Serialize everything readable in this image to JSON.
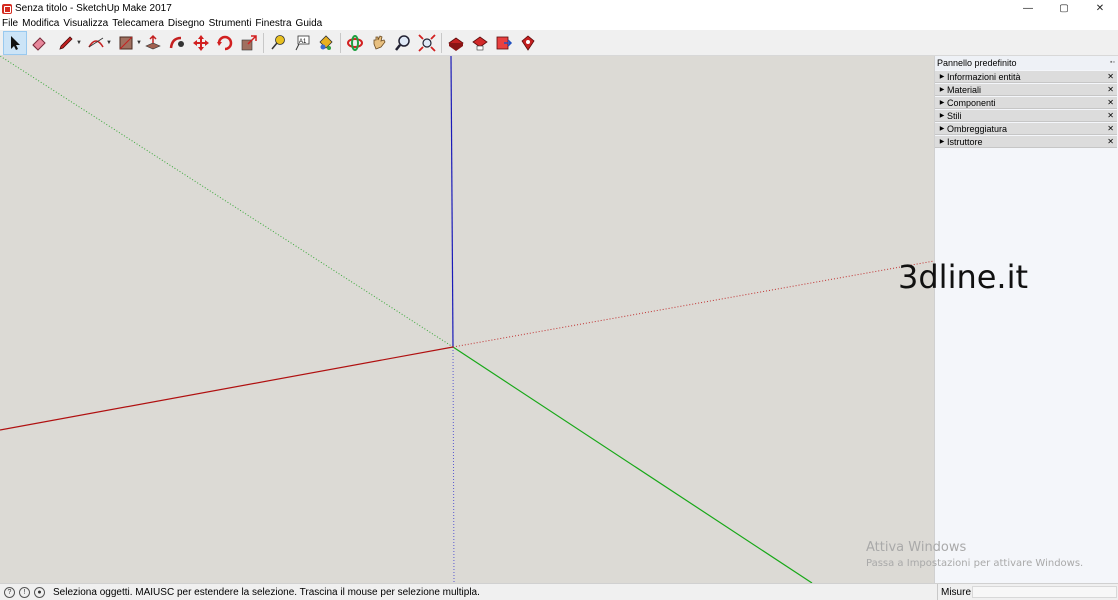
{
  "window": {
    "title": "Senza titolo - SketchUp Make 2017",
    "minimize": "—",
    "restore": "▢",
    "close": "✕"
  },
  "menu": [
    "File",
    "Modifica",
    "Visualizza",
    "Telecamera",
    "Disegno",
    "Strumenti",
    "Finestra",
    "Guida"
  ],
  "toolbar": {
    "tools": [
      "select-icon",
      "eraser-icon",
      "pencil-icon",
      "arc-icon",
      "shape-icon",
      "push-pull-icon",
      "follow-me-icon",
      "move-icon",
      "rotate-icon",
      "scale-icon",
      "tape-measure-icon",
      "text-icon",
      "paint-bucket-icon",
      "orbit-icon",
      "pan-icon",
      "zoom-icon",
      "zoom-extents-icon",
      "warehouse-icon",
      "extension-warehouse-icon",
      "send-to-layout-icon",
      "extension-manager-icon"
    ],
    "text_tool_label": "A1"
  },
  "panel": {
    "title": "Pannello predefinito",
    "trays": [
      "Informazioni entità",
      "Materiali",
      "Componenti",
      "Stili",
      "Ombreggiatura",
      "Istruttore"
    ]
  },
  "overlay": {
    "brand": "3dline.it",
    "activate_title": "Attiva Windows",
    "activate_sub": "Passa a Impostazioni per attivare Windows."
  },
  "status": {
    "message": "Seleziona oggetti. MAIUSC per estendere la selezione. Trascina il mouse per selezione multipla.",
    "measure_label": "Misure",
    "measure_value": ""
  },
  "colors": {
    "viewport_bg": "#dcdad5",
    "red_axis": "#b01010",
    "green_axis": "#18a818",
    "blue_axis": "#1a1ab8"
  }
}
